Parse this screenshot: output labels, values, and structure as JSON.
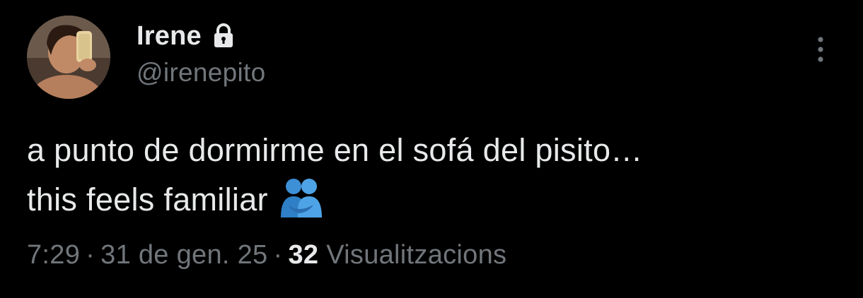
{
  "author": {
    "display_name": "Irene",
    "handle": "@irenepito",
    "protected": true
  },
  "tweet": {
    "text_lines": [
      "a punto de dormirme en el sofá del pisito…",
      "this feels familiar"
    ],
    "emoji": "people-hugging"
  },
  "meta": {
    "time": "7:29",
    "separator": "·",
    "date": "31 de gen. 25",
    "views_count": "32",
    "views_label": "Visualitzacions"
  },
  "icons": {
    "lock": "lock-icon",
    "more": "more-vertical-icon",
    "avatar": "avatar"
  },
  "colors": {
    "background": "#000000",
    "primary_text": "#e7e9ea",
    "secondary_text": "#71767b"
  }
}
